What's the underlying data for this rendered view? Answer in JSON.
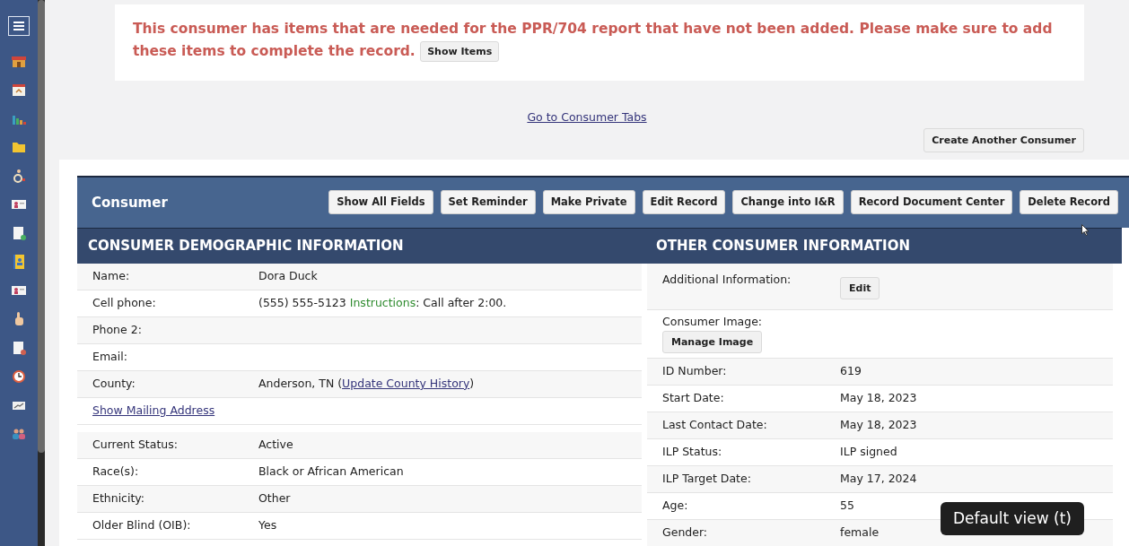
{
  "alert": {
    "message": "This consumer has items that are needed for the PPR/704 report that have not been added. Please make sure to add these items to complete the record.",
    "button": "Show Items"
  },
  "tabs_link": "Go to Consumer Tabs",
  "create_button": "Create Another Consumer",
  "panel": {
    "title": "Consumer",
    "buttons": [
      "Show All Fields",
      "Set Reminder",
      "Make Private",
      "Edit Record",
      "Change into I&R",
      "Record Document Center",
      "Delete Record"
    ]
  },
  "demographics": {
    "heading": "CONSUMER DEMOGRAPHIC INFORMATION",
    "rows": [
      {
        "kind": "field",
        "label": "Name:",
        "value": "Dora Duck"
      },
      {
        "kind": "field",
        "label": "Cell phone:",
        "value": "(555) 555-5123",
        "note_label": "Instructions",
        "note": ": Call after 2:00."
      },
      {
        "kind": "field",
        "label": "Phone 2:"
      },
      {
        "kind": "field",
        "label": "Email:"
      },
      {
        "kind": "field",
        "label": "County:",
        "value": "Anderson, TN (",
        "link": "Update County History",
        "suffix": ")"
      },
      {
        "kind": "link",
        "label": "Show Mailing Address"
      },
      {
        "kind": "field",
        "label": "Current Status:",
        "value": "Active"
      },
      {
        "kind": "field",
        "label": "Race(s):",
        "value": "Black or African American"
      },
      {
        "kind": "field",
        "label": "Ethnicity:",
        "value": "Other"
      },
      {
        "kind": "field",
        "label": "Older Blind (OIB):",
        "value": "Yes"
      }
    ]
  },
  "other": {
    "heading": "OTHER CONSUMER INFORMATION",
    "rows": [
      {
        "kind": "button",
        "label": "Additional Information:",
        "button": "Edit"
      },
      {
        "kind": "stacked_button",
        "label": "Consumer Image:",
        "button": "Manage Image"
      },
      {
        "kind": "field",
        "label": "ID Number:",
        "value": "619"
      },
      {
        "kind": "field",
        "label": "Start Date:",
        "value": "May 18, 2023"
      },
      {
        "kind": "field",
        "label": "Last Contact Date:",
        "value": "May 18, 2023"
      },
      {
        "kind": "field",
        "label": "ILP Status:",
        "value": "ILP signed"
      },
      {
        "kind": "field",
        "label": "ILP Target Date:",
        "value": "May 17, 2024"
      },
      {
        "kind": "field",
        "label": "Age:",
        "value": "55"
      },
      {
        "kind": "field",
        "label": "Gender:",
        "value": "female"
      }
    ]
  },
  "tooltip": "Default view (t)"
}
